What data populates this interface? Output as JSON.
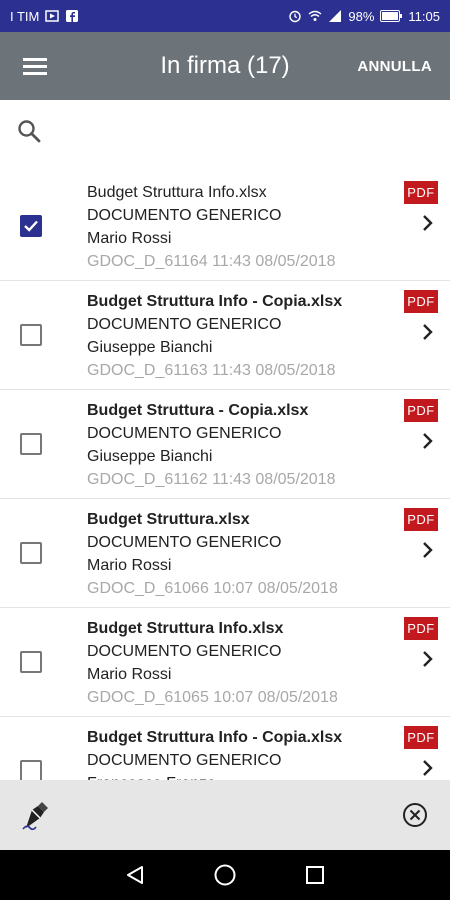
{
  "status_bar": {
    "carrier": "I TIM",
    "battery": "98%",
    "time": "11:05",
    "icons": [
      "play-icon",
      "facebook-icon",
      "alarm-icon",
      "wifi-icon",
      "signal-icon",
      "battery-icon"
    ]
  },
  "app_bar": {
    "title": "In firma (17)",
    "cancel_label": "ANNULLA",
    "background": "#6d7479",
    "icons": [
      "menu-icon"
    ]
  },
  "search": {
    "icon": "search-icon"
  },
  "documents": [
    {
      "name": "Budget Struttura Info.xlsx",
      "name_bold": false,
      "type": "DOCUMENTO GENERICO",
      "author": "Mario Rossi",
      "meta": "GDOC_D_61164  11:43 08/05/2018",
      "badge": "PDF",
      "checked": true
    },
    {
      "name": "Budget Struttura Info - Copia.xlsx",
      "name_bold": true,
      "type": "DOCUMENTO GENERICO",
      "author": "Giuseppe Bianchi",
      "meta": "GDOC_D_61163  11:43 08/05/2018",
      "badge": "PDF",
      "checked": false
    },
    {
      "name": "Budget Struttura - Copia.xlsx",
      "name_bold": true,
      "type": "DOCUMENTO GENERICO",
      "author": "Giuseppe Bianchi",
      "meta": "GDOC_D_61162  11:43 08/05/2018",
      "badge": "PDF",
      "checked": false
    },
    {
      "name": "Budget Struttura.xlsx",
      "name_bold": true,
      "type": "DOCUMENTO GENERICO",
      "author": "Mario Rossi",
      "meta": "GDOC_D_61066  10:07 08/05/2018",
      "badge": "PDF",
      "checked": false
    },
    {
      "name": "Budget Struttura Info.xlsx",
      "name_bold": true,
      "type": "DOCUMENTO GENERICO",
      "author": "Mario Rossi",
      "meta": "GDOC_D_61065  10:07 08/05/2018",
      "badge": "PDF",
      "checked": false
    },
    {
      "name": "Budget Struttura Info - Copia.xlsx",
      "name_bold": true,
      "type": "DOCUMENTO GENERICO",
      "author": "Francesco Franzo",
      "meta": "",
      "badge": "PDF",
      "checked": false
    }
  ],
  "colors": {
    "status_bar": "#2c3191",
    "checkbox_checked": "#2c3191",
    "pdf_badge": "#c1191e",
    "meta_text": "#a8a8a8",
    "bottom_bar": "#e6e6e6"
  },
  "bottom_bar": {
    "icons": [
      "sign-pen-icon",
      "close-circle-icon"
    ]
  },
  "nav_bar": {
    "icons": [
      "back-icon",
      "home-icon",
      "recents-icon"
    ]
  }
}
